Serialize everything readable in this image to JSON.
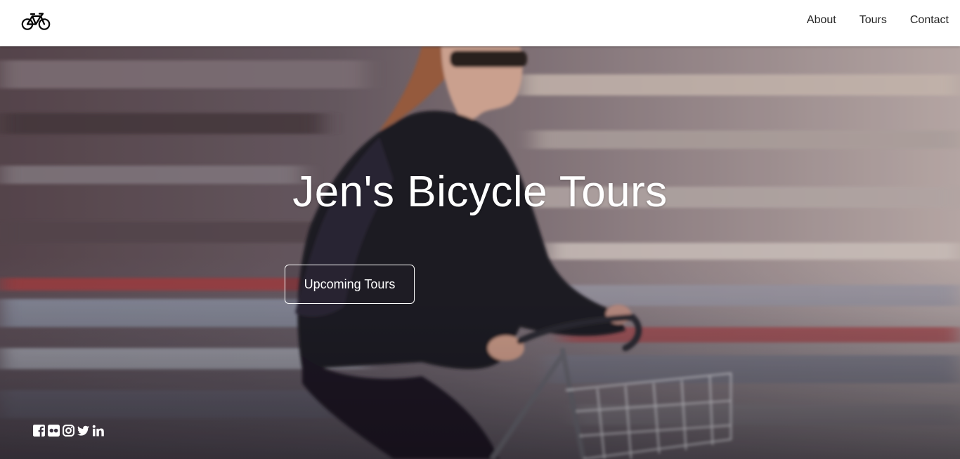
{
  "nav": {
    "logo_icon": "bicycle-icon",
    "items": [
      {
        "label": "About"
      },
      {
        "label": "Tours"
      },
      {
        "label": "Contact"
      }
    ]
  },
  "hero": {
    "title": "Jen's Bicycle Tours",
    "button_label": "Upcoming Tours"
  },
  "social": {
    "icons": [
      "facebook-icon",
      "flickr-icon",
      "instagram-icon",
      "twitter-icon",
      "linkedin-icon"
    ]
  },
  "colors": {
    "header_bg": "#ffffff",
    "nav_text": "#222222",
    "hero_text": "#ffffff"
  }
}
